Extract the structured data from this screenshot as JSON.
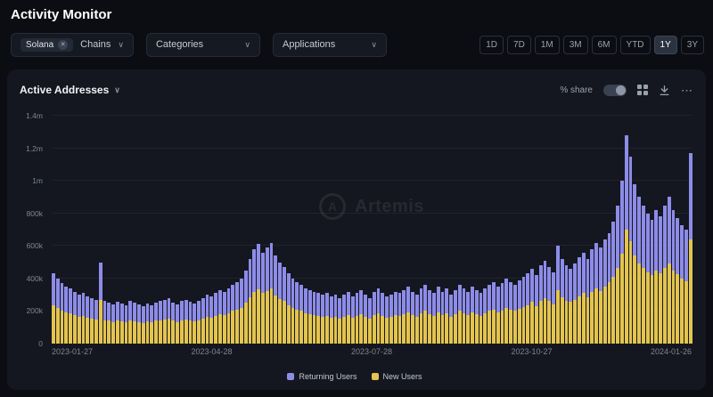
{
  "header": {
    "title": "Activity Monitor"
  },
  "icons": {
    "chevron_down": "∨",
    "close": "✕",
    "more": "⋯",
    "logo_letter": "A"
  },
  "filters": {
    "chains": {
      "label": "Chains",
      "chip": "Solana"
    },
    "categories": {
      "label": "Categories"
    },
    "applications": {
      "label": "Applications"
    }
  },
  "time_ranges": {
    "options": [
      "1D",
      "7D",
      "1M",
      "3M",
      "6M",
      "YTD",
      "1Y",
      "3Y"
    ],
    "selected": "1Y"
  },
  "panel": {
    "title": "Active Addresses",
    "share_toggle_label": "% share"
  },
  "chart_data": {
    "type": "bar",
    "stacked": true,
    "title": "Active Addresses",
    "unit": "thousands",
    "ylim": [
      0,
      1400
    ],
    "y_ticks": [
      "0",
      "200k",
      "400k",
      "600k",
      "800k",
      "1m",
      "1.2m",
      "1.4m"
    ],
    "x_ticks": [
      "2023-01-27",
      "2023-04-28",
      "2023-07-28",
      "2023-10-27",
      "2024-01-26"
    ],
    "legend_position": "bottom",
    "grid": true,
    "watermark": "Artemis",
    "legend": [
      {
        "name": "Returning Users",
        "color": "#8d8ce8"
      },
      {
        "name": "New Users",
        "color": "#e3c44e"
      }
    ],
    "series": [
      {
        "name": "New Users",
        "color": "#e3c44e",
        "values": [
          235,
          220,
          205,
          190,
          185,
          175,
          165,
          170,
          160,
          155,
          150,
          270,
          145,
          140,
          130,
          140,
          135,
          130,
          145,
          135,
          130,
          125,
          135,
          130,
          140,
          145,
          150,
          155,
          140,
          130,
          145,
          150,
          140,
          135,
          145,
          155,
          165,
          160,
          170,
          180,
          175,
          185,
          200,
          210,
          220,
          250,
          285,
          320,
          335,
          310,
          325,
          340,
          295,
          275,
          260,
          235,
          220,
          210,
          200,
          185,
          180,
          175,
          170,
          165,
          170,
          160,
          165,
          155,
          165,
          175,
          160,
          170,
          180,
          165,
          155,
          175,
          185,
          170,
          160,
          165,
          175,
          170,
          180,
          190,
          175,
          165,
          185,
          200,
          180,
          170,
          190,
          175,
          185,
          165,
          180,
          200,
          185,
          175,
          190,
          180,
          170,
          185,
          200,
          210,
          190,
          205,
          220,
          210,
          200,
          215,
          225,
          235,
          255,
          230,
          265,
          280,
          260,
          240,
          330,
          285,
          265,
          255,
          270,
          290,
          310,
          285,
          320,
          340,
          325,
          350,
          375,
          410,
          465,
          550,
          700,
          630,
          540,
          495,
          465,
          440,
          420,
          450,
          430,
          465,
          495,
          450,
          425,
          400,
          385,
          640
        ]
      },
      {
        "name": "Returning Users",
        "color": "#8d8ce8",
        "values": [
          195,
          180,
          165,
          160,
          155,
          145,
          135,
          140,
          130,
          125,
          120,
          230,
          115,
          110,
          110,
          115,
          110,
          105,
          115,
          115,
          110,
          105,
          110,
          105,
          110,
          115,
          120,
          125,
          110,
          110,
          115,
          120,
          115,
          110,
          120,
          125,
          135,
          130,
          140,
          150,
          145,
          155,
          160,
          170,
          180,
          200,
          235,
          260,
          275,
          250,
          265,
          280,
          245,
          225,
          210,
          195,
          180,
          170,
          160,
          155,
          150,
          145,
          140,
          135,
          140,
          130,
          135,
          125,
          135,
          145,
          130,
          140,
          150,
          135,
          125,
          145,
          155,
          140,
          130,
          135,
          145,
          140,
          150,
          160,
          145,
          135,
          155,
          160,
          150,
          140,
          160,
          145,
          155,
          135,
          150,
          160,
          155,
          145,
          160,
          150,
          140,
          155,
          160,
          170,
          160,
          165,
          180,
          170,
          160,
          175,
          185,
          195,
          205,
          190,
          215,
          230,
          210,
          200,
          270,
          235,
          215,
          205,
          220,
          240,
          250,
          235,
          260,
          280,
          265,
          290,
          305,
          340,
          385,
          450,
          580,
          520,
          440,
          405,
          385,
          360,
          340,
          370,
          350,
          385,
          405,
          370,
          345,
          330,
          315,
          530
        ]
      }
    ]
  }
}
